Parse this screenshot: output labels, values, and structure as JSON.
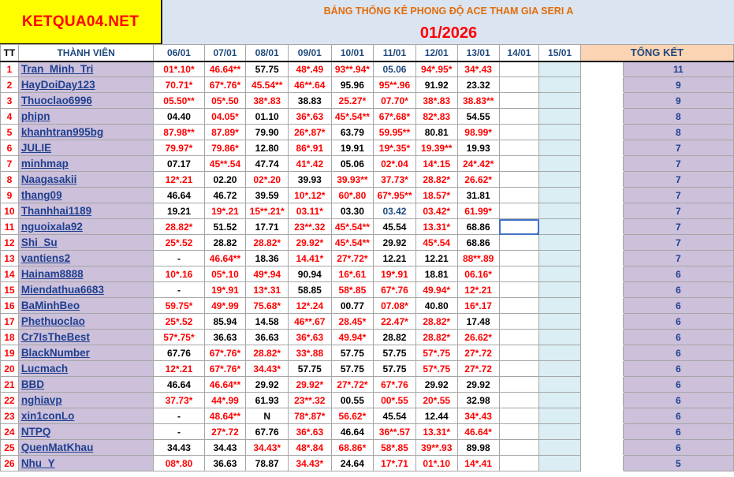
{
  "brand": "KETQUA04.NET",
  "title": "BẢNG THỐNG KÊ PHONG ĐỘ ACE THAM GIA SERI A",
  "month": "01/2026",
  "headers": {
    "tt": "TT",
    "member": "THÀNH VIÊN",
    "dates": [
      "06/01",
      "07/01",
      "08/01",
      "09/01",
      "10/01",
      "11/01",
      "12/01",
      "13/01",
      "14/01",
      "15/01"
    ],
    "total": "TỔNG KẾT"
  },
  "colors": {
    "red": "#ff0000",
    "dark": "#000000",
    "blue": "#1f497d",
    "name_bg": "#ccc0da"
  },
  "rows": [
    {
      "tt": "1",
      "name": "Tran_Minh_Tri",
      "vals": [
        [
          "01*.10*",
          "r"
        ],
        [
          "46.64**",
          "r"
        ],
        [
          "57.75",
          "d"
        ],
        [
          "48*.49",
          "r"
        ],
        [
          "93**.94*",
          "r"
        ],
        [
          "05.06",
          "b"
        ],
        [
          "94*.95*",
          "r"
        ],
        [
          "34*.43",
          "r"
        ]
      ],
      "total": "11"
    },
    {
      "tt": "2",
      "name": "HayDoiDay123",
      "vals": [
        [
          "70.71*",
          "r"
        ],
        [
          "67*.76*",
          "r"
        ],
        [
          "45.54**",
          "r"
        ],
        [
          "46**.64",
          "r"
        ],
        [
          "95.96",
          "d"
        ],
        [
          "95**.96",
          "r"
        ],
        [
          "91.92",
          "d"
        ],
        [
          "23.32",
          "d"
        ]
      ],
      "total": "9"
    },
    {
      "tt": "3",
      "name": "Thuoclao6996",
      "vals": [
        [
          "05.50**",
          "r"
        ],
        [
          "05*.50",
          "r"
        ],
        [
          "38*.83",
          "r"
        ],
        [
          "38.83",
          "d"
        ],
        [
          "25.27*",
          "r"
        ],
        [
          "07.70*",
          "r"
        ],
        [
          "38*.83",
          "r"
        ],
        [
          "38.83**",
          "r"
        ]
      ],
      "total": "9"
    },
    {
      "tt": "4",
      "name": "phipn",
      "vals": [
        [
          "04.40",
          "d"
        ],
        [
          "04.05*",
          "r"
        ],
        [
          "01.10",
          "d"
        ],
        [
          "36*.63",
          "r"
        ],
        [
          "45*.54**",
          "r"
        ],
        [
          "67*.68*",
          "r"
        ],
        [
          "82*.83",
          "r"
        ],
        [
          "54.55",
          "d"
        ]
      ],
      "total": "8"
    },
    {
      "tt": "5",
      "name": "khanhtran995bg",
      "vals": [
        [
          "87.98**",
          "r"
        ],
        [
          "87.89*",
          "r"
        ],
        [
          "79.90",
          "d"
        ],
        [
          "26*.87*",
          "r"
        ],
        [
          "63.79",
          "d"
        ],
        [
          "59.95**",
          "r"
        ],
        [
          "80.81",
          "d"
        ],
        [
          "98.99*",
          "r"
        ]
      ],
      "total": "8"
    },
    {
      "tt": "6",
      "name": "JULIE",
      "vals": [
        [
          "79.97*",
          "r"
        ],
        [
          "79.86*",
          "r"
        ],
        [
          "12.80",
          "d"
        ],
        [
          "86*.91",
          "r"
        ],
        [
          "19.91",
          "d"
        ],
        [
          "19*.35*",
          "r"
        ],
        [
          "19.39**",
          "r"
        ],
        [
          "19.93",
          "d"
        ]
      ],
      "total": "7"
    },
    {
      "tt": "7",
      "name": "minhmap",
      "vals": [
        [
          "07.17",
          "d"
        ],
        [
          "45**.54",
          "r"
        ],
        [
          "47.74",
          "d"
        ],
        [
          "41*.42",
          "r"
        ],
        [
          "05.06",
          "d"
        ],
        [
          "02*.04",
          "r"
        ],
        [
          "14*.15",
          "r"
        ],
        [
          "24*.42*",
          "r"
        ]
      ],
      "total": "7"
    },
    {
      "tt": "8",
      "name": "Naagasakii",
      "vals": [
        [
          "12*.21",
          "r"
        ],
        [
          "02.20",
          "d"
        ],
        [
          "02*.20",
          "r"
        ],
        [
          "39.93",
          "d"
        ],
        [
          "39.93**",
          "r"
        ],
        [
          "37.73*",
          "r"
        ],
        [
          "28.82*",
          "r"
        ],
        [
          "26.62*",
          "r"
        ]
      ],
      "total": "7"
    },
    {
      "tt": "9",
      "name": "thang09",
      "vals": [
        [
          "46.64",
          "d"
        ],
        [
          "46.72",
          "d"
        ],
        [
          "39.59",
          "d"
        ],
        [
          "10*.12*",
          "r"
        ],
        [
          "60*.80",
          "r"
        ],
        [
          "67*.95**",
          "r"
        ],
        [
          "18.57*",
          "r"
        ],
        [
          "31.81",
          "d"
        ]
      ],
      "total": "7"
    },
    {
      "tt": "10",
      "name": "Thanhhai1189",
      "vals": [
        [
          "19.21",
          "d"
        ],
        [
          "19*.21",
          "r"
        ],
        [
          "15**.21*",
          "r"
        ],
        [
          "03.11*",
          "r"
        ],
        [
          "03.30",
          "d"
        ],
        [
          "03.42",
          "b"
        ],
        [
          "03.42*",
          "r"
        ],
        [
          "61.99*",
          "r"
        ]
      ],
      "total": "7"
    },
    {
      "tt": "11",
      "name": "nguoixala92",
      "vals": [
        [
          "28.82*",
          "r"
        ],
        [
          "51.52",
          "d"
        ],
        [
          "17.71",
          "d"
        ],
        [
          "23**.32",
          "r"
        ],
        [
          "45*.54**",
          "r"
        ],
        [
          "45.54",
          "d"
        ],
        [
          "13.31*",
          "r"
        ],
        [
          "68.86",
          "d"
        ]
      ],
      "total": "7"
    },
    {
      "tt": "12",
      "name": "Shi_Su",
      "vals": [
        [
          "25*.52",
          "r"
        ],
        [
          "28.82",
          "d"
        ],
        [
          "28.82*",
          "r"
        ],
        [
          "29.92*",
          "r"
        ],
        [
          "45*.54**",
          "r"
        ],
        [
          "29.92",
          "d"
        ],
        [
          "45*.54",
          "r"
        ],
        [
          "68.86",
          "d"
        ]
      ],
      "total": "7"
    },
    {
      "tt": "13",
      "name": "vantiens2",
      "vals": [
        [
          "-",
          "d"
        ],
        [
          "46.64**",
          "r"
        ],
        [
          "18.36",
          "d"
        ],
        [
          "14.41*",
          "r"
        ],
        [
          "27*.72*",
          "r"
        ],
        [
          "12.21",
          "d"
        ],
        [
          "12.21",
          "d"
        ],
        [
          "88**.89",
          "r"
        ]
      ],
      "total": "7"
    },
    {
      "tt": "14",
      "name": "Hainam8888",
      "vals": [
        [
          "10*.16",
          "r"
        ],
        [
          "05*.10",
          "r"
        ],
        [
          "49*.94",
          "r"
        ],
        [
          "90.94",
          "d"
        ],
        [
          "16*.61",
          "r"
        ],
        [
          "19*.91",
          "r"
        ],
        [
          "18.81",
          "d"
        ],
        [
          "06.16*",
          "r"
        ]
      ],
      "total": "6"
    },
    {
      "tt": "15",
      "name": "Miendathua6683",
      "vals": [
        [
          "-",
          "d"
        ],
        [
          "19*.91",
          "r"
        ],
        [
          "13*.31",
          "r"
        ],
        [
          "58.85",
          "d"
        ],
        [
          "58*.85",
          "r"
        ],
        [
          "67*.76",
          "r"
        ],
        [
          "49.94*",
          "r"
        ],
        [
          "12*.21",
          "r"
        ]
      ],
      "total": "6"
    },
    {
      "tt": "16",
      "name": "BaMinhBeo",
      "vals": [
        [
          "59.75*",
          "r"
        ],
        [
          "49*.99",
          "r"
        ],
        [
          "75.68*",
          "r"
        ],
        [
          "12*.24",
          "r"
        ],
        [
          "00.77",
          "d"
        ],
        [
          "07.08*",
          "r"
        ],
        [
          "40.80",
          "d"
        ],
        [
          "16*.17",
          "r"
        ]
      ],
      "total": "6"
    },
    {
      "tt": "17",
      "name": "Phethuoclao",
      "vals": [
        [
          "25*.52",
          "r"
        ],
        [
          "85.94",
          "d"
        ],
        [
          "14.58",
          "d"
        ],
        [
          "46**.67",
          "r"
        ],
        [
          "28.45*",
          "r"
        ],
        [
          "22.47*",
          "r"
        ],
        [
          "28.82*",
          "r"
        ],
        [
          "17.48",
          "d"
        ]
      ],
      "total": "6"
    },
    {
      "tt": "18",
      "name": "Cr7IsTheBest",
      "vals": [
        [
          "57*.75*",
          "r"
        ],
        [
          "36.63",
          "d"
        ],
        [
          "36.63",
          "d"
        ],
        [
          "36*.63",
          "r"
        ],
        [
          "49.94*",
          "r"
        ],
        [
          "28.82",
          "d"
        ],
        [
          "28.82*",
          "r"
        ],
        [
          "26.62*",
          "r"
        ]
      ],
      "total": "6"
    },
    {
      "tt": "19",
      "name": "BlackNumber",
      "vals": [
        [
          "67.76",
          "d"
        ],
        [
          "67*.76*",
          "r"
        ],
        [
          "28.82*",
          "r"
        ],
        [
          "33*.88",
          "r"
        ],
        [
          "57.75",
          "d"
        ],
        [
          "57.75",
          "d"
        ],
        [
          "57*.75",
          "r"
        ],
        [
          "27*.72",
          "r"
        ]
      ],
      "total": "6"
    },
    {
      "tt": "20",
      "name": "Lucmach",
      "vals": [
        [
          "12*.21",
          "r"
        ],
        [
          "67*.76*",
          "r"
        ],
        [
          "34.43*",
          "r"
        ],
        [
          "57.75",
          "d"
        ],
        [
          "57.75",
          "d"
        ],
        [
          "57.75",
          "d"
        ],
        [
          "57*.75",
          "r"
        ],
        [
          "27*.72",
          "r"
        ]
      ],
      "total": "6"
    },
    {
      "tt": "21",
      "name": "BBD",
      "vals": [
        [
          "46.64",
          "d"
        ],
        [
          "46.64**",
          "r"
        ],
        [
          "29.92",
          "d"
        ],
        [
          "29.92*",
          "r"
        ],
        [
          "27*.72*",
          "r"
        ],
        [
          "67*.76",
          "r"
        ],
        [
          "29.92",
          "d"
        ],
        [
          "29.92",
          "d"
        ]
      ],
      "total": "6"
    },
    {
      "tt": "22",
      "name": "nghiavp",
      "vals": [
        [
          "37.73*",
          "r"
        ],
        [
          "44*.99",
          "r"
        ],
        [
          "61.93",
          "d"
        ],
        [
          "23**.32",
          "r"
        ],
        [
          "00.55",
          "d"
        ],
        [
          "00*.55",
          "r"
        ],
        [
          "20*.55",
          "r"
        ],
        [
          "32.98",
          "d"
        ]
      ],
      "total": "6"
    },
    {
      "tt": "23",
      "name": "xin1conLo",
      "vals": [
        [
          "-",
          "d"
        ],
        [
          "48.64**",
          "r"
        ],
        [
          "N",
          "d"
        ],
        [
          "78*.87*",
          "r"
        ],
        [
          "56.62*",
          "r"
        ],
        [
          "45.54",
          "d"
        ],
        [
          "12.44",
          "d"
        ],
        [
          "34*.43",
          "r"
        ]
      ],
      "total": "6"
    },
    {
      "tt": "24",
      "name": "NTPQ",
      "vals": [
        [
          "-",
          "d"
        ],
        [
          "27*.72",
          "r"
        ],
        [
          "67.76",
          "d"
        ],
        [
          "36*.63",
          "r"
        ],
        [
          "46.64",
          "d"
        ],
        [
          "36**.57",
          "r"
        ],
        [
          "13.31*",
          "r"
        ],
        [
          "46.64*",
          "r"
        ]
      ],
      "total": "6"
    },
    {
      "tt": "25",
      "name": "QuenMatKhau",
      "vals": [
        [
          "34.43",
          "d"
        ],
        [
          "34.43",
          "d"
        ],
        [
          "34.43*",
          "r"
        ],
        [
          "48*.84",
          "r"
        ],
        [
          "68.86*",
          "r"
        ],
        [
          "58*.85",
          "r"
        ],
        [
          "39**.93",
          "r"
        ],
        [
          "89.98",
          "d"
        ]
      ],
      "total": "6"
    },
    {
      "tt": "26",
      "name": "Nhu_Y",
      "vals": [
        [
          "08*.80",
          "r"
        ],
        [
          "36.63",
          "d"
        ],
        [
          "78.87",
          "d"
        ],
        [
          "34.43*",
          "r"
        ],
        [
          "24.64",
          "d"
        ],
        [
          "17*.71",
          "r"
        ],
        [
          "01*.10",
          "r"
        ],
        [
          "14*.41",
          "r"
        ]
      ],
      "total": "5"
    }
  ]
}
